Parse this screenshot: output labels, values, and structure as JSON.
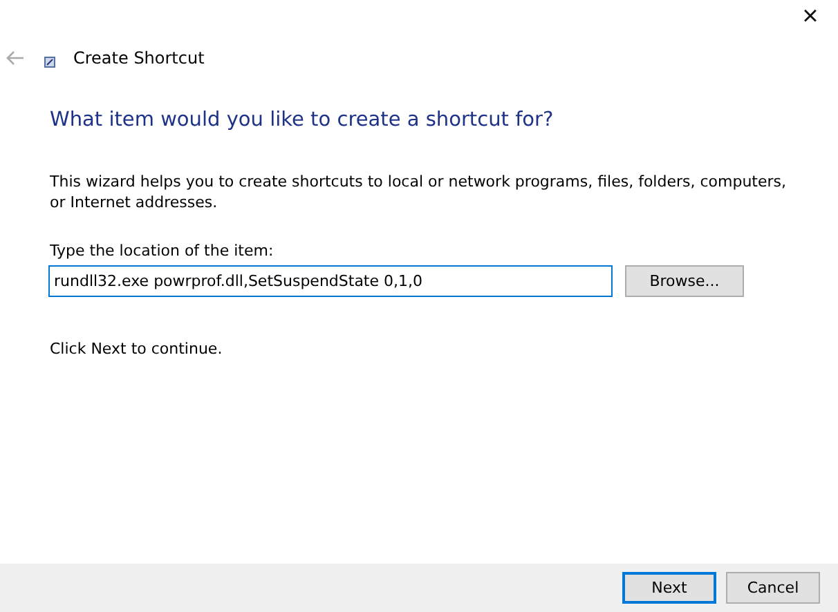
{
  "window": {
    "title": "Create Shortcut",
    "close": "×"
  },
  "heading": "What item would you like to create a shortcut for?",
  "intro": "This wizard helps you to create shortcuts to local or network programs, files, folders, computers, or Internet addresses.",
  "location": {
    "label": "Type the location of the item:",
    "value": "rundll32.exe powrprof.dll,SetSuspendState 0,1,0",
    "browse": "Browse..."
  },
  "hint": "Click Next to continue.",
  "buttons": [
    {
      "label": "Next",
      "default": true
    },
    {
      "label": "Cancel",
      "default": false
    }
  ]
}
